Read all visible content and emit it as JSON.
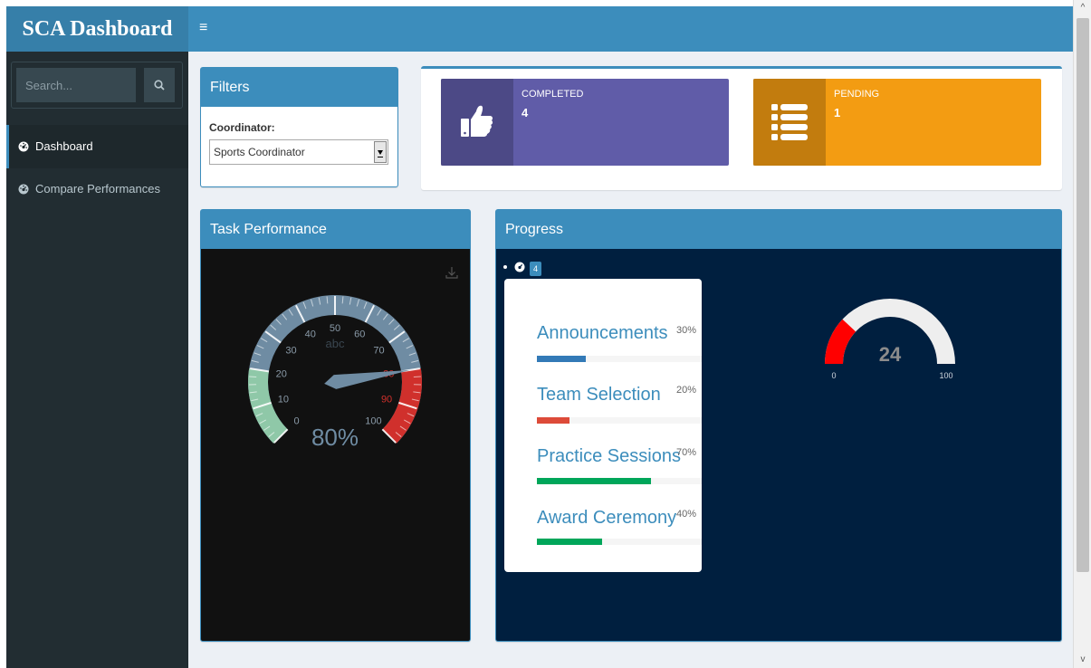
{
  "app": {
    "title": "SCA Dashboard",
    "menu_toggle": "≡"
  },
  "sidebar": {
    "search_placeholder": "Search...",
    "items": [
      {
        "label": "Dashboard",
        "active": true
      },
      {
        "label": "Compare Performances",
        "active": false
      }
    ]
  },
  "filters": {
    "title": "Filters",
    "coordinator_label": "Coordinator:",
    "coordinator_value": "Sports Coordinator"
  },
  "info_boxes": {
    "completed": {
      "label": "COMPLETED",
      "value": "4",
      "color": "#605ca8",
      "icon": "thumbs-up-icon"
    },
    "pending": {
      "label": "PENDING",
      "value": "1",
      "color": "#f39c12",
      "icon": "list-icon"
    }
  },
  "task_performance": {
    "title": "Task Performance",
    "gauge": {
      "value": 80,
      "display": "80%",
      "units": "abc",
      "min": 0,
      "max": 100,
      "tick_labels": [
        "0",
        "10",
        "20",
        "30",
        "40",
        "50",
        "60",
        "70",
        "80",
        "90",
        "100"
      ],
      "green_band": [
        0,
        20
      ],
      "red_band": [
        80,
        100
      ]
    }
  },
  "progress": {
    "title": "Progress",
    "tab_badge": "4",
    "tasks": [
      {
        "name": "Announcements",
        "percent": "30%",
        "fraction": 0.3,
        "color": "#337ab7"
      },
      {
        "name": "Team Selection",
        "percent": "20%",
        "fraction": 0.2,
        "color": "#dd4b39"
      },
      {
        "name": "Practice Sessions",
        "percent": "70%",
        "fraction": 0.7,
        "color": "#00a65a"
      },
      {
        "name": "Award Ceremony",
        "percent": "40%",
        "fraction": 0.4,
        "color": "#00a65a"
      }
    ],
    "gauge": {
      "value": "24",
      "fraction": 0.24,
      "min": "0",
      "max": "100",
      "color": "#ff0000"
    }
  }
}
